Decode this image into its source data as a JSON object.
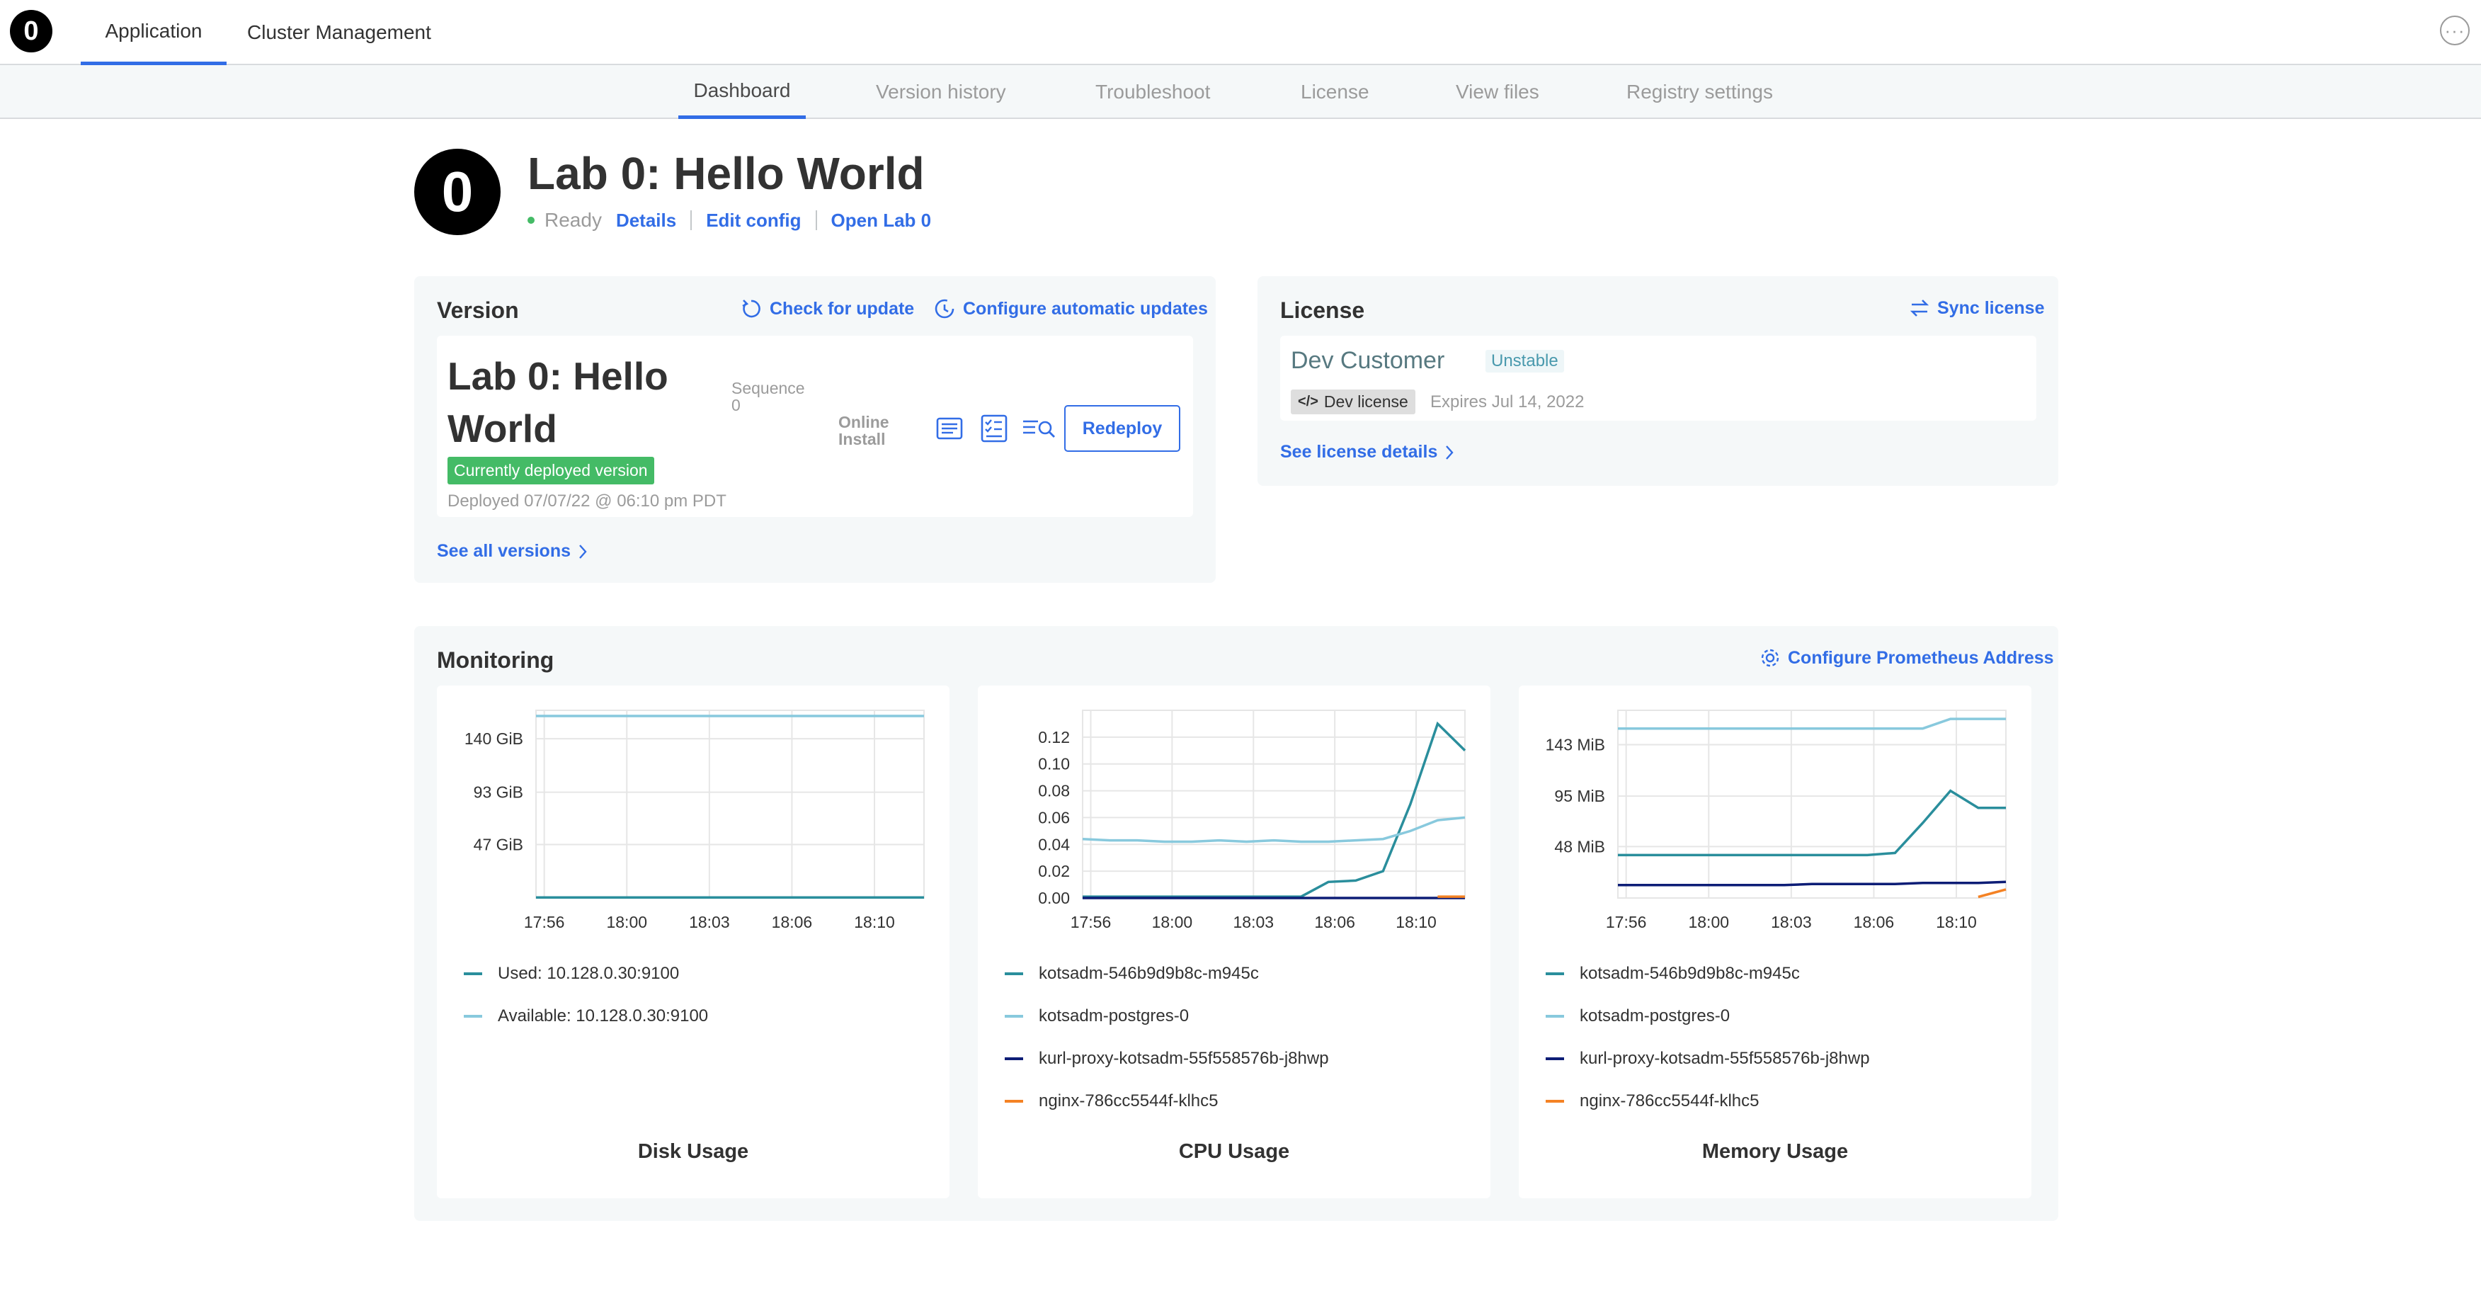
{
  "nav": {
    "logo_text": "0",
    "tabs": [
      {
        "label": "Application",
        "active": true
      },
      {
        "label": "Cluster Management",
        "active": false
      }
    ],
    "more_icon": "ellipsis-circle-icon"
  },
  "subnav": {
    "tabs": [
      {
        "label": "Dashboard",
        "active": true
      },
      {
        "label": "Version history",
        "active": false
      },
      {
        "label": "Troubleshoot",
        "active": false
      },
      {
        "label": "License",
        "active": false
      },
      {
        "label": "View files",
        "active": false
      },
      {
        "label": "Registry settings",
        "active": false
      }
    ]
  },
  "app": {
    "icon_text": "0",
    "title": "Lab 0: Hello World",
    "status": "Ready",
    "status_color": "#44bb66",
    "links": {
      "details": "Details",
      "edit_config": "Edit config",
      "open": "Open Lab 0"
    }
  },
  "version_card": {
    "title": "Version",
    "check_update": "Check for update",
    "configure_updates": "Configure automatic updates",
    "version_title": "Lab 0: Hello World",
    "sequence_label": "Sequence",
    "sequence_value": "0",
    "install_type": "Online Install",
    "deployed_badge": "Currently deployed version",
    "deployed_date": "Deployed 07/07/22 @ 06:10 pm PDT",
    "redeploy": "Redeploy",
    "see_all": "See all versions",
    "icons": [
      "release-notes-icon",
      "preflight-checks-icon",
      "view-logs-icon"
    ]
  },
  "license_card": {
    "title": "License",
    "sync": "Sync license",
    "customer": "Dev Customer",
    "channel": "Unstable",
    "license_type": "Dev license",
    "expires": "Expires Jul 14, 2022",
    "see_details": "See license details"
  },
  "monitoring": {
    "title": "Monitoring",
    "configure": "Configure Prometheus Address"
  },
  "colors": {
    "accent": "#326de6",
    "teal": "#2a8e9c",
    "light_blue": "#88c9dd",
    "navy": "#0d1d76",
    "orange": "#f48224",
    "card_bg": "#f5f8f9"
  },
  "chart_data": [
    {
      "type": "line",
      "title": "Disk Usage",
      "x": [
        "17:56",
        "18:00",
        "18:03",
        "18:06",
        "18:10"
      ],
      "y_ticks": [
        "47 GiB",
        "93 GiB",
        "140 GiB"
      ],
      "ylim": [
        0,
        165
      ],
      "series": [
        {
          "name": "Used: 10.128.0.30:9100",
          "color": "#2a8e9c",
          "values": [
            0.5,
            0.5,
            0.5,
            0.5,
            0.5,
            0.5
          ]
        },
        {
          "name": "Available: 10.128.0.30:9100",
          "color": "#88c9dd",
          "values": [
            160,
            160,
            160,
            160,
            160,
            160
          ]
        }
      ]
    },
    {
      "type": "line",
      "title": "CPU Usage",
      "x": [
        "17:56",
        "18:00",
        "18:03",
        "18:06",
        "18:10"
      ],
      "y_ticks": [
        "0.00",
        "0.02",
        "0.04",
        "0.06",
        "0.08",
        "0.10",
        "0.12"
      ],
      "ylim": [
        0,
        0.14
      ],
      "series": [
        {
          "name": "kotsadm-546b9d9b8c-m945c",
          "color": "#2a8e9c",
          "values": [
            0.001,
            0.001,
            0.001,
            0.001,
            0.001,
            0.001,
            0.001,
            0.001,
            0.001,
            0.012,
            0.013,
            0.02,
            0.07,
            0.13,
            0.11
          ]
        },
        {
          "name": "kotsadm-postgres-0",
          "color": "#88c9dd",
          "values": [
            0.044,
            0.043,
            0.043,
            0.042,
            0.042,
            0.043,
            0.042,
            0.043,
            0.042,
            0.042,
            0.043,
            0.044,
            0.05,
            0.058,
            0.06
          ]
        },
        {
          "name": "kurl-proxy-kotsadm-55f558576b-j8hwp",
          "color": "#0d1d76",
          "values": [
            0.0,
            0.0,
            0.0,
            0.0,
            0.0,
            0.0,
            0.0,
            0.0,
            0.0,
            0.0,
            0.0,
            0.0,
            0.0,
            0.0,
            0.0
          ]
        },
        {
          "name": "nginx-786cc5544f-klhc5",
          "color": "#f48224",
          "values": [
            null,
            null,
            null,
            null,
            null,
            null,
            null,
            null,
            null,
            null,
            null,
            null,
            null,
            0.001,
            0.001
          ]
        }
      ]
    },
    {
      "type": "line",
      "title": "Memory Usage",
      "x": [
        "17:56",
        "18:00",
        "18:03",
        "18:06",
        "18:10"
      ],
      "y_ticks": [
        "48 MiB",
        "95 MiB",
        "143 MiB"
      ],
      "ylim": [
        0,
        175
      ],
      "series": [
        {
          "name": "kotsadm-546b9d9b8c-m945c",
          "color": "#2a8e9c",
          "values": [
            40,
            40,
            40,
            40,
            40,
            40,
            40,
            40,
            40,
            40,
            42,
            70,
            100,
            84,
            84
          ]
        },
        {
          "name": "kotsadm-postgres-0",
          "color": "#88c9dd",
          "values": [
            158,
            158,
            158,
            158,
            158,
            158,
            158,
            158,
            158,
            158,
            158,
            158,
            167,
            167,
            167
          ]
        },
        {
          "name": "kurl-proxy-kotsadm-55f558576b-j8hwp",
          "color": "#0d1d76",
          "values": [
            12,
            12,
            12,
            12,
            12,
            12,
            12,
            13,
            13,
            13,
            13,
            14,
            14,
            14,
            15
          ]
        },
        {
          "name": "nginx-786cc5544f-klhc5",
          "color": "#f48224",
          "values": [
            null,
            null,
            null,
            null,
            null,
            null,
            null,
            null,
            null,
            null,
            null,
            null,
            null,
            1,
            8
          ]
        }
      ]
    }
  ]
}
